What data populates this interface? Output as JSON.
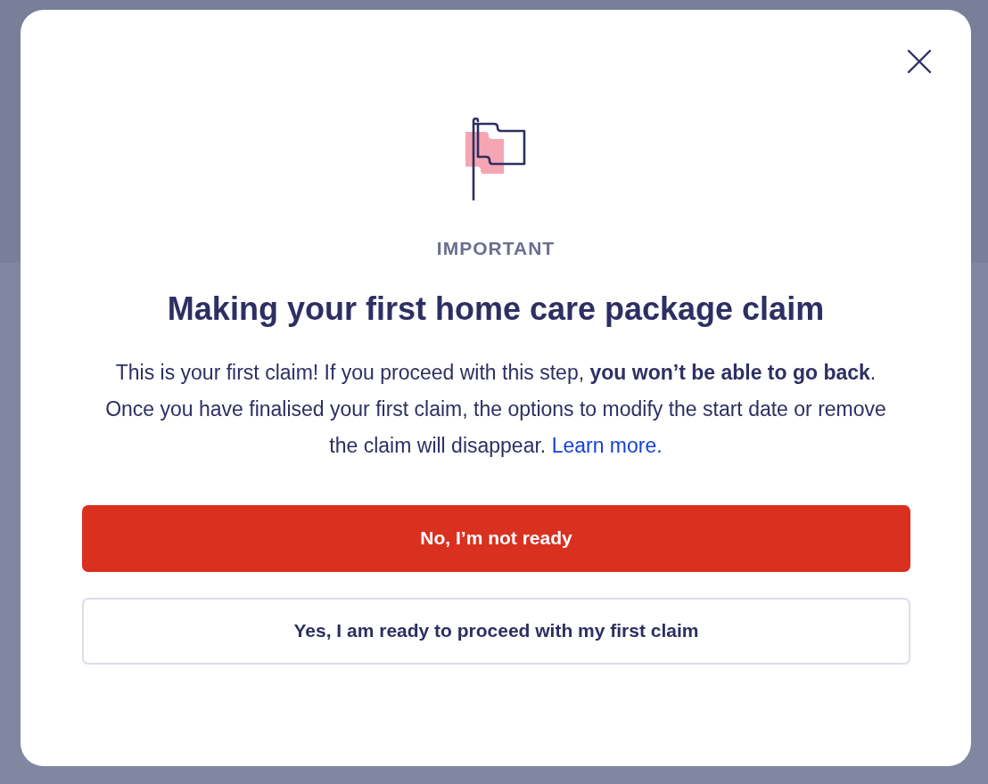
{
  "dialog": {
    "eyebrow": "IMPORTANT",
    "title": "Making your first home care package claim",
    "message": "This is your first claim! If you proceed with this step, **you won’t be able to go back**. Once you have finalised your first claim, the options to modify the start date or remove the claim will disappear.",
    "link": "Learn more.",
    "buttons": [
      {
        "kind": "primary",
        "label": "No, I’m not ready"
      },
      {
        "kind": "secondary",
        "label": "Yes, I am ready to proceed with my first claim"
      }
    ]
  }
}
